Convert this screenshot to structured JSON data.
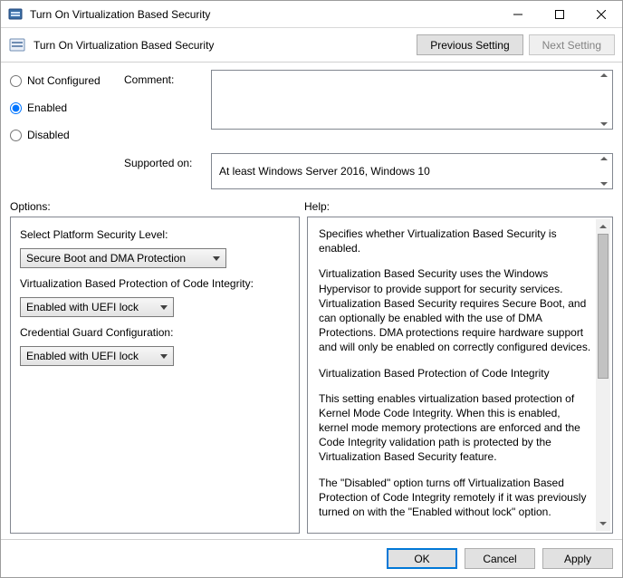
{
  "window": {
    "title": "Turn On Virtualization Based Security",
    "header_title": "Turn On Virtualization Based Security"
  },
  "nav": {
    "previous": "Previous Setting",
    "next": "Next Setting"
  },
  "state": {
    "not_configured": "Not Configured",
    "enabled": "Enabled",
    "disabled": "Disabled",
    "selected": "enabled"
  },
  "fields": {
    "comment_label": "Comment:",
    "comment_value": "",
    "supported_label": "Supported on:",
    "supported_value": "At least Windows Server 2016, Windows 10"
  },
  "section_labels": {
    "options": "Options:",
    "help": "Help:"
  },
  "options": {
    "platform_label": "Select Platform Security Level:",
    "platform_value": "Secure Boot and DMA Protection",
    "vbpci_label": "Virtualization Based Protection of Code Integrity:",
    "vbpci_value": "Enabled with UEFI lock",
    "credguard_label": "Credential Guard Configuration:",
    "credguard_value": "Enabled with UEFI lock"
  },
  "help": {
    "p1": "Specifies whether Virtualization Based Security is enabled.",
    "p2": "Virtualization Based Security uses the Windows Hypervisor to provide support for security services. Virtualization Based Security requires Secure Boot, and can optionally be enabled with the use of DMA Protections. DMA protections require hardware support and will only be enabled on correctly configured devices.",
    "p3": "Virtualization Based Protection of Code Integrity",
    "p4": "This setting enables virtualization based protection of Kernel Mode Code Integrity. When this is enabled, kernel mode memory protections are enforced and the Code Integrity validation path is protected by the Virtualization Based Security feature.",
    "p5": "The \"Disabled\" option turns off Virtualization Based Protection of Code Integrity remotely if it was previously turned on with the \"Enabled without lock\" option."
  },
  "footer": {
    "ok": "OK",
    "cancel": "Cancel",
    "apply": "Apply"
  }
}
